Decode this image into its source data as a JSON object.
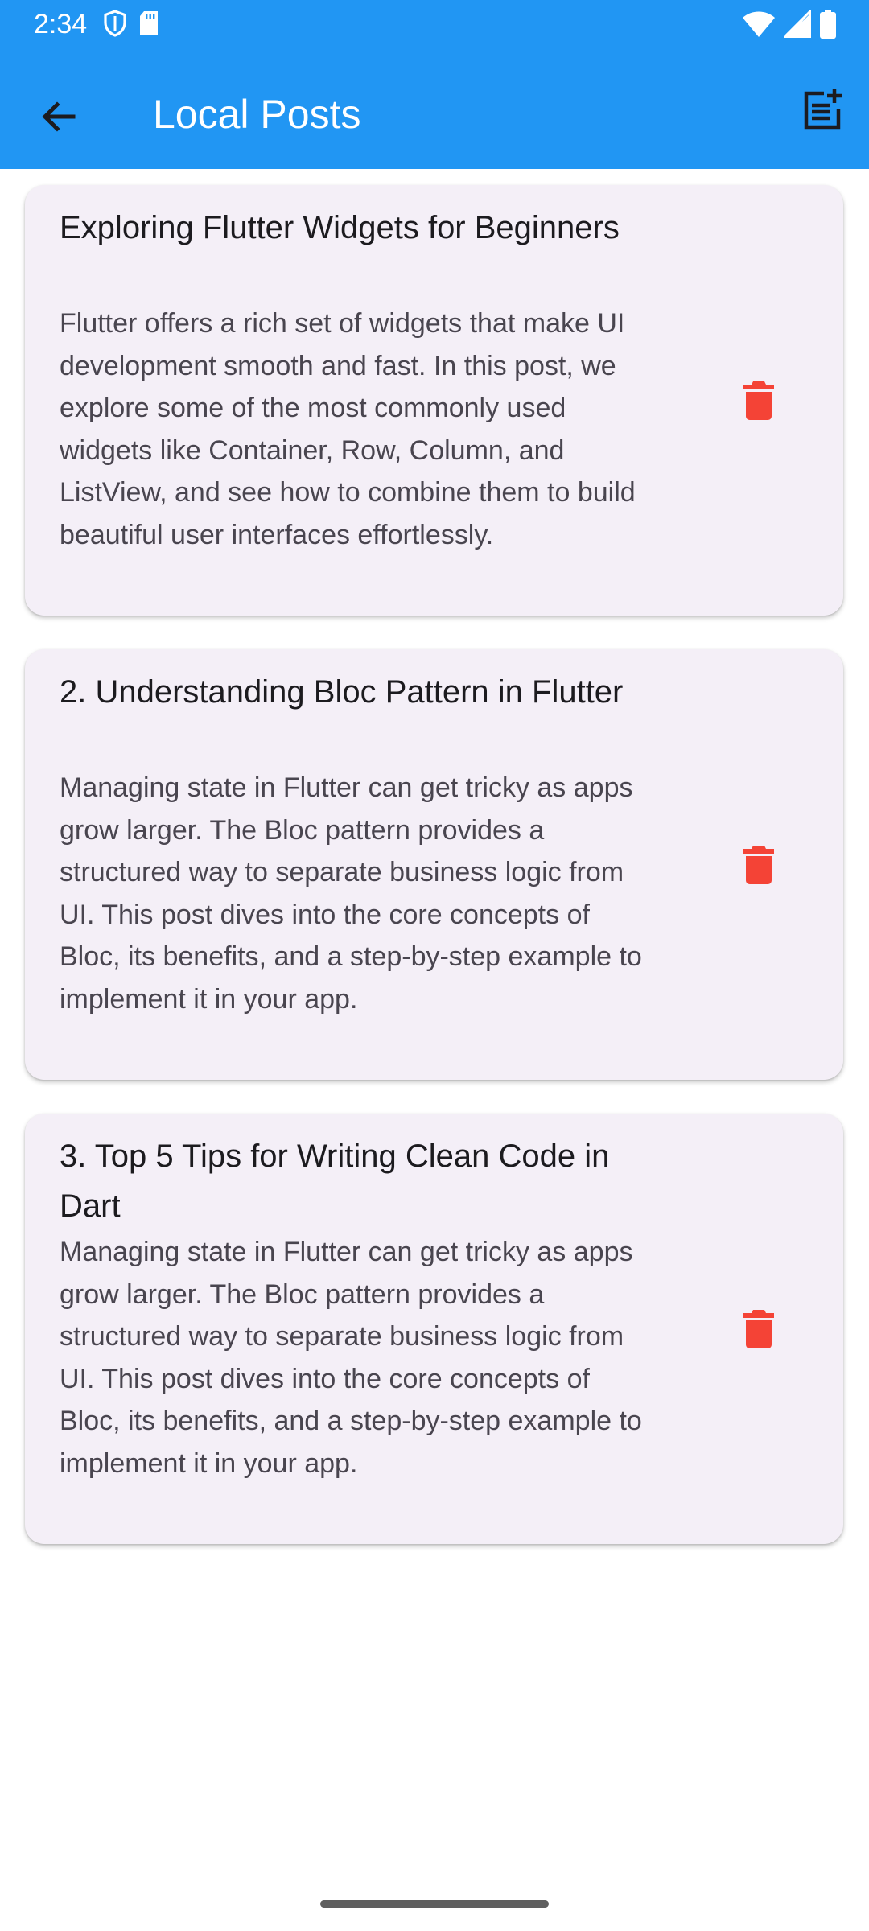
{
  "status_bar": {
    "time": "2:34",
    "icons": [
      "shield-icon",
      "sd-card-icon",
      "wifi-icon",
      "signal-icon",
      "battery-icon"
    ]
  },
  "app_bar": {
    "title": "Local Posts",
    "back_icon": "arrow-back-icon",
    "action_icon": "post-add-icon",
    "background": "#2196F3"
  },
  "posts": [
    {
      "title": "Exploring Flutter Widgets for Beginners",
      "body": "Flutter offers a rich set of widgets that make UI development smooth and fast. In this post, we explore some of the most commonly used widgets like Container, Row, Column, and ListView, and see how to combine them to build beautiful user interfaces effortlessly."
    },
    {
      "title": "2. Understanding Bloc Pattern in Flutter",
      "body": "Managing state in Flutter can get tricky as apps grow larger. The Bloc pattern provides a structured way to separate business logic from UI. This post dives into the core concepts of Bloc, its benefits, and a step-by-step example to implement it in your app."
    },
    {
      "title": "3. Top 5 Tips for Writing Clean Code in Dart",
      "body": "Managing state in Flutter can get tricky as apps grow larger. The Bloc pattern provides a structured way to separate business logic from UI. This post dives into the core concepts of Bloc, its benefits, and a step-by-step example to implement it in your app."
    }
  ],
  "colors": {
    "card_background": "#F4EFF7",
    "delete_icon": "#F44336"
  }
}
